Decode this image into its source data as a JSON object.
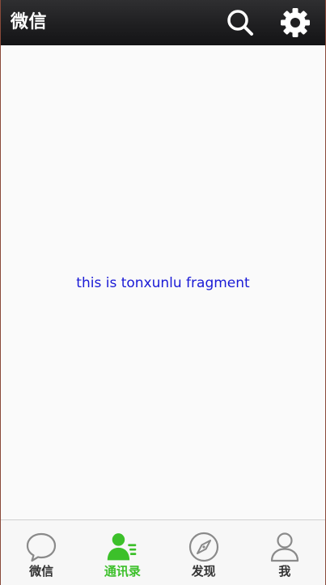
{
  "topbar": {
    "title": "微信",
    "actions": [
      {
        "icon": "search-icon"
      },
      {
        "icon": "gear-icon"
      }
    ]
  },
  "content": {
    "text": "this is tonxunlu fragment",
    "text_color": "#1a1ad6"
  },
  "bottom_nav": {
    "active_color": "#3cc02a",
    "items": [
      {
        "label": "微信",
        "icon": "chat-bubble-icon",
        "active": false
      },
      {
        "label": "通讯录",
        "icon": "contacts-icon",
        "active": true
      },
      {
        "label": "发现",
        "icon": "compass-icon",
        "active": false
      },
      {
        "label": "我",
        "icon": "person-icon",
        "active": false
      }
    ]
  }
}
